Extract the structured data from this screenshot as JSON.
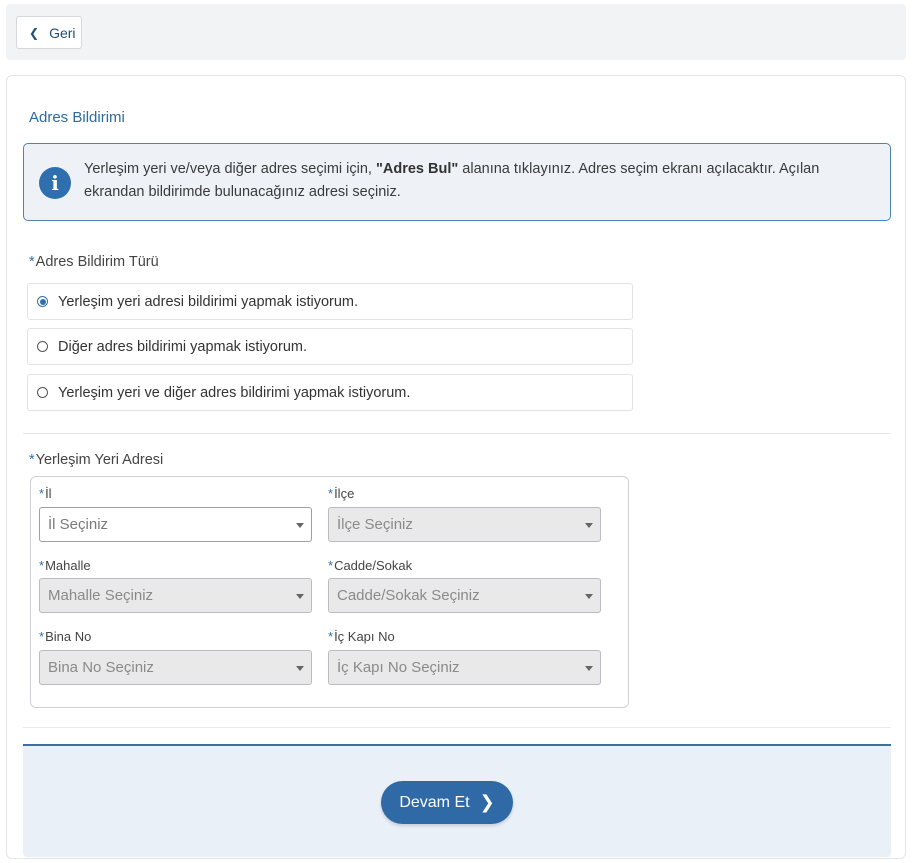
{
  "topbar": {
    "back_label": "Geri",
    "back_icon": "chevron-left-icon"
  },
  "section": {
    "title": "Adres Bildirimi"
  },
  "info": {
    "text_before": "Yerleşim yeri ve/veya diğer adres seçimi için, ",
    "text_bold": "\"Adres Bul\"",
    "text_after": " alanına tıklayınız. Adres seçim ekranı açılacaktır. Açılan ekrandan bildirimde bulunacağınız adresi seçiniz.",
    "icon": "info-icon"
  },
  "bildirim_turu": {
    "required_mark": "*",
    "label": "Adres Bildirim Türü",
    "options": [
      {
        "label": "Yerleşim yeri adresi bildirimi yapmak istiyorum.",
        "checked": true
      },
      {
        "label": "Diğer adres bildirimi yapmak istiyorum.",
        "checked": false
      },
      {
        "label": "Yerleşim yeri ve diğer adres bildirimi yapmak istiyorum.",
        "checked": false
      }
    ]
  },
  "yerlesim": {
    "required_mark": "*",
    "label": "Yerleşim Yeri Adresi",
    "fields": {
      "il": {
        "label": "İl",
        "placeholder": "İl Seçiniz"
      },
      "ilce": {
        "label": "İlçe",
        "placeholder": "İlçe Seçiniz"
      },
      "mahalle": {
        "label": "Mahalle",
        "placeholder": "Mahalle Seçiniz"
      },
      "cadde": {
        "label": "Cadde/Sokak",
        "placeholder": "Cadde/Sokak Seçiniz"
      },
      "bina": {
        "label": "Bina No",
        "placeholder": "Bina No Seçiniz"
      },
      "ickapi": {
        "label": "İç Kapı No",
        "placeholder": "İç Kapı No Seçiniz"
      }
    }
  },
  "footer": {
    "continue_label": "Devam Et",
    "continue_icon": "chevron-right-icon"
  },
  "colors": {
    "accent": "#2f6fae",
    "button": "#2f6aa7",
    "footer_bg": "#eaf0f8"
  }
}
